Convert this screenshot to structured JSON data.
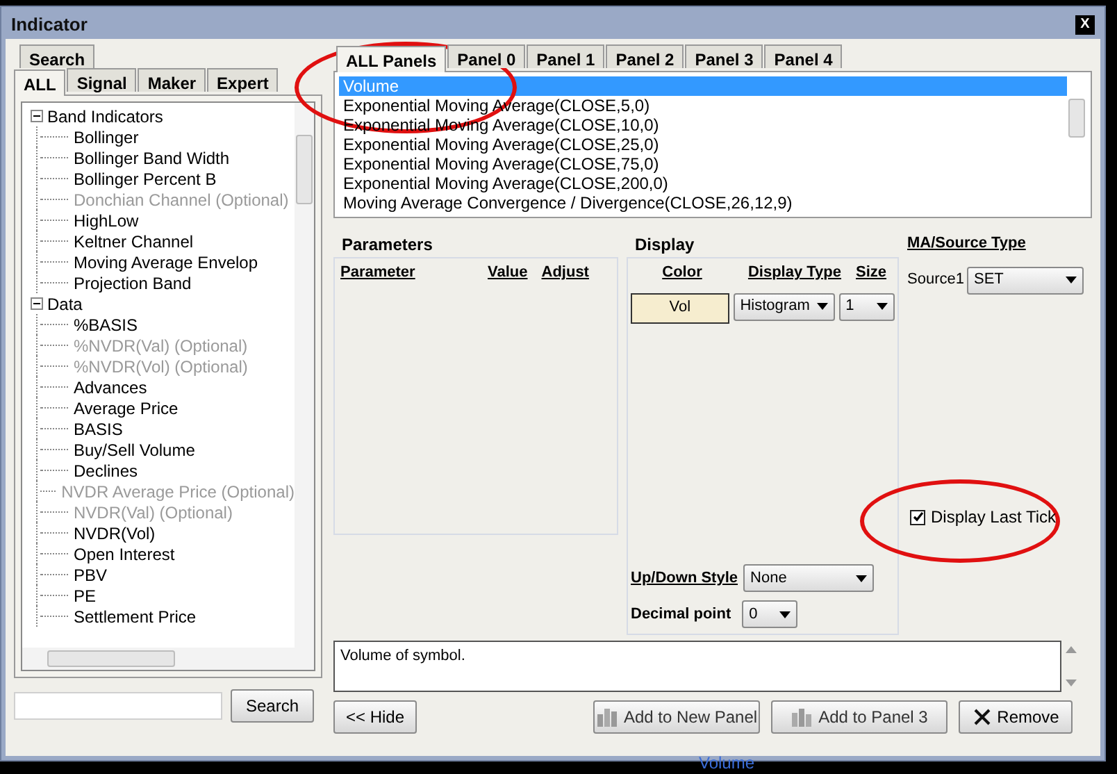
{
  "window": {
    "title": "Indicator",
    "close": "X"
  },
  "left_tabs": {
    "back_row": [
      {
        "label": "Search",
        "selected": false
      }
    ],
    "front_row": [
      {
        "label": "ALL",
        "selected": true
      },
      {
        "label": "Signal",
        "selected": false
      },
      {
        "label": "Maker",
        "selected": false
      },
      {
        "label": "Expert",
        "selected": false
      }
    ]
  },
  "tree": [
    {
      "label": "Band Indicators",
      "expanded": true,
      "children": [
        {
          "label": "Bollinger",
          "disabled": false
        },
        {
          "label": "Bollinger Band Width",
          "disabled": false
        },
        {
          "label": "Bollinger Percent B",
          "disabled": false
        },
        {
          "label": "Donchian Channel (Optional)",
          "disabled": true
        },
        {
          "label": "HighLow",
          "disabled": false
        },
        {
          "label": "Keltner Channel",
          "disabled": false
        },
        {
          "label": "Moving Average Envelop",
          "disabled": false
        },
        {
          "label": "Projection Band",
          "disabled": false
        }
      ]
    },
    {
      "label": "Data",
      "expanded": true,
      "children": [
        {
          "label": "%BASIS",
          "disabled": false
        },
        {
          "label": "%NVDR(Val) (Optional)",
          "disabled": true
        },
        {
          "label": "%NVDR(Vol) (Optional)",
          "disabled": true
        },
        {
          "label": "Advances",
          "disabled": false
        },
        {
          "label": "Average Price",
          "disabled": false
        },
        {
          "label": "BASIS",
          "disabled": false
        },
        {
          "label": "Buy/Sell Volume",
          "disabled": false
        },
        {
          "label": "Declines",
          "disabled": false
        },
        {
          "label": "NVDR Average Price (Optional)",
          "disabled": true
        },
        {
          "label": "NVDR(Val) (Optional)",
          "disabled": true
        },
        {
          "label": "NVDR(Vol)",
          "disabled": false
        },
        {
          "label": "Open Interest",
          "disabled": false
        },
        {
          "label": "PBV",
          "disabled": false
        },
        {
          "label": "PE",
          "disabled": false
        },
        {
          "label": "Settlement Price",
          "disabled": false
        }
      ]
    }
  ],
  "search_button": "Search",
  "hide_button": "<< Hide",
  "panel_tabs": [
    {
      "label": "ALL Panels",
      "selected": true
    },
    {
      "label": "Panel 0",
      "selected": false
    },
    {
      "label": "Panel 1",
      "selected": false
    },
    {
      "label": "Panel 2",
      "selected": false
    },
    {
      "label": "Panel 3",
      "selected": false
    },
    {
      "label": "Panel 4",
      "selected": false
    }
  ],
  "indicators": [
    {
      "label": "Volume",
      "selected": true
    },
    {
      "label": "Exponential Moving Average(CLOSE,5,0)",
      "selected": false
    },
    {
      "label": "Exponential Moving Average(CLOSE,10,0)",
      "selected": false
    },
    {
      "label": "Exponential Moving Average(CLOSE,25,0)",
      "selected": false
    },
    {
      "label": "Exponential Moving Average(CLOSE,75,0)",
      "selected": false
    },
    {
      "label": "Exponential Moving Average(CLOSE,200,0)",
      "selected": false
    },
    {
      "label": "Moving Average Convergence / Divergence(CLOSE,26,12,9)",
      "selected": false
    }
  ],
  "parameters": {
    "title": "Parameters",
    "columns": [
      "Parameter",
      "Value",
      "Adjust"
    ]
  },
  "display": {
    "title": "Display",
    "columns": [
      "Color",
      "Display Type",
      "Size"
    ],
    "color_label": "Vol",
    "display_type": "Histogram",
    "size": "1",
    "up_down_label": "Up/Down Style",
    "up_down_value": "None",
    "decimal_label": "Decimal point",
    "decimal_value": "0"
  },
  "ma_source": {
    "title": "MA/Source Type",
    "source_label": "Source1",
    "source_value": "SET",
    "display_last_tick": {
      "label": "Display Last Tick",
      "checked": true
    }
  },
  "description": "Volume of symbol.",
  "buttons": [
    {
      "label": "Add to New Panel",
      "kind": "add-new"
    },
    {
      "label": "Add to Panel 3",
      "kind": "add-panel"
    },
    {
      "label": "Remove",
      "kind": "remove"
    }
  ],
  "background_label": "Volume"
}
